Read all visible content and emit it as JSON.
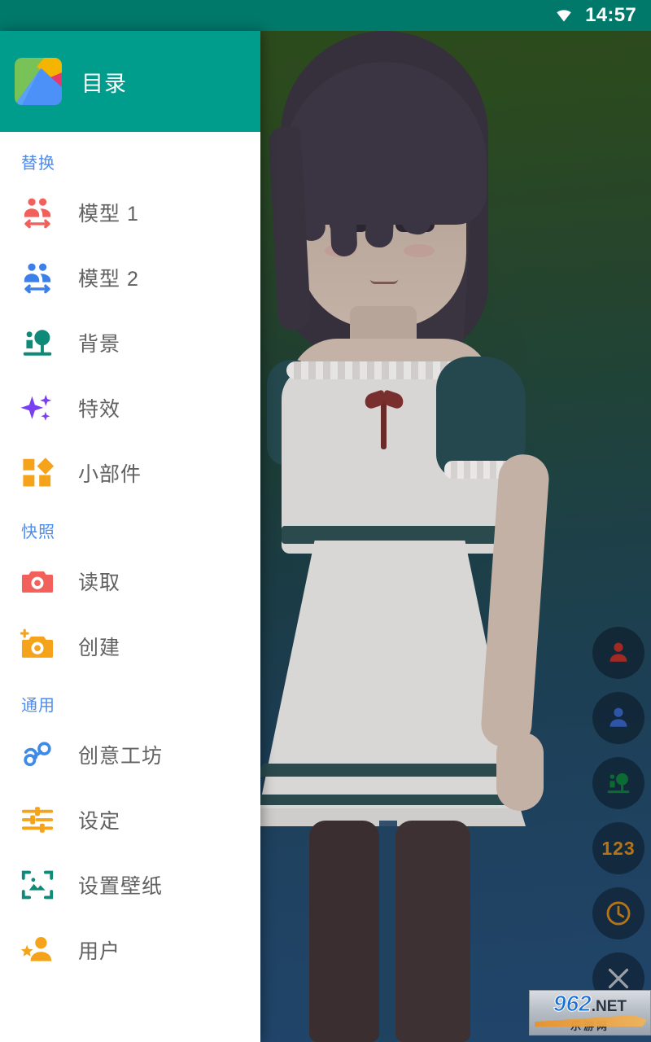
{
  "status_bar": {
    "time": "14:57",
    "wifi_icon": "wifi-icon",
    "background_color": "#00786a"
  },
  "drawer": {
    "title": "目录",
    "app_icon": "play-store-icon",
    "header_color": "#009d8c",
    "section_label_color": "#4c8cf0",
    "sections": [
      {
        "label": "替换",
        "items": [
          {
            "label": "模型 1",
            "icon": "people-swap-icon",
            "color": "#f2605c"
          },
          {
            "label": "模型 2",
            "icon": "people-swap-icon",
            "color": "#3d7fe8"
          },
          {
            "label": "背景",
            "icon": "park-tree-icon",
            "color": "#0f8a78"
          },
          {
            "label": "特效",
            "icon": "sparkles-icon",
            "color": "#7b3ff2"
          },
          {
            "label": "小部件",
            "icon": "widgets-icon",
            "color": "#f5a31a"
          }
        ]
      },
      {
        "label": "快照",
        "items": [
          {
            "label": "读取",
            "icon": "camera-icon",
            "color": "#f2605c"
          },
          {
            "label": "创建",
            "icon": "camera-add-icon",
            "color": "#f5a31a"
          }
        ]
      },
      {
        "label": "通用",
        "items": [
          {
            "label": "创意工坊",
            "icon": "steam-icon",
            "color": "#3d8ae8"
          },
          {
            "label": "设定",
            "icon": "sliders-icon",
            "color": "#f5a31a"
          },
          {
            "label": "设置壁纸",
            "icon": "wallpaper-icon",
            "color": "#0f8a78"
          },
          {
            "label": "用户",
            "icon": "user-star-icon",
            "color": "#f5a31a"
          }
        ]
      }
    ]
  },
  "fab_rail": [
    {
      "name": "model-1-fab",
      "icon": "person-icon",
      "color": "#a32a23",
      "label": ""
    },
    {
      "name": "model-2-fab",
      "icon": "person-icon",
      "color": "#2f55a8",
      "label": ""
    },
    {
      "name": "background-fab",
      "icon": "park-tree-icon",
      "color": "#0c6b33",
      "label": ""
    },
    {
      "name": "counter-fab",
      "icon": "number-icon",
      "color": "#b37518",
      "label": "123"
    },
    {
      "name": "clock-fab",
      "icon": "clock-icon",
      "color": "#b37518",
      "label": ""
    },
    {
      "name": "close-fab",
      "icon": "close-icon",
      "color": "#9aa0a6",
      "label": ""
    }
  ],
  "watermark": {
    "brand": "962",
    "suffix": ".NET",
    "subtitle": "乐游网"
  }
}
